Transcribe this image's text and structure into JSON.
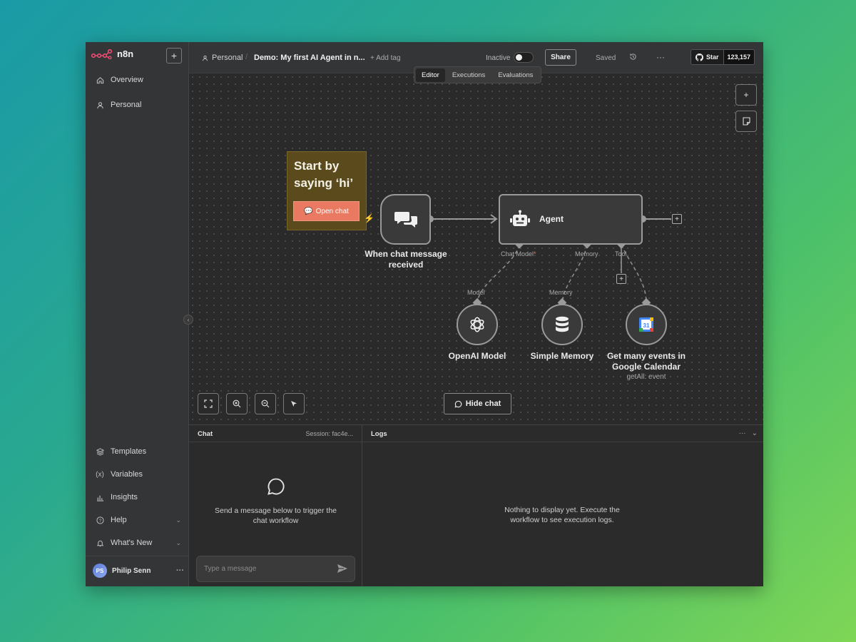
{
  "app": {
    "brand": "n8n"
  },
  "sidebar": {
    "items": [
      {
        "label": "Overview",
        "icon": "home-icon"
      },
      {
        "label": "Personal",
        "icon": "user-icon"
      }
    ],
    "bottom_items": [
      {
        "label": "Templates",
        "icon": "templates-icon"
      },
      {
        "label": "Variables",
        "icon": "variables-icon"
      },
      {
        "label": "Insights",
        "icon": "insights-icon"
      },
      {
        "label": "Help",
        "icon": "help-icon"
      },
      {
        "label": "What's New",
        "icon": "bell-icon"
      }
    ],
    "user": {
      "initials": "PS",
      "name": "Philip Senn"
    }
  },
  "header": {
    "project": "Personal",
    "workflow_name": "Demo: My first AI Agent in n...",
    "add_tag": "+ Add tag",
    "status": "Inactive",
    "share": "Share",
    "saved": "Saved",
    "github_star": "Star",
    "github_count": "123,157",
    "tabs": [
      {
        "label": "Editor",
        "active": true
      },
      {
        "label": "Executions",
        "active": false
      },
      {
        "label": "Evaluations",
        "active": false
      }
    ]
  },
  "canvas": {
    "sticky_note": {
      "text": "Start by saying ‘hi’",
      "button": "Open chat",
      "color": "#5b4a1b"
    },
    "nodes": {
      "trigger": {
        "label": "When chat message received"
      },
      "agent": {
        "label": "Agent",
        "connectors": {
          "chat_model": "Chat Model",
          "chat_model_required": "*",
          "memory": "Memory",
          "tool": "Tool"
        }
      },
      "openai": {
        "label": "OpenAI Model",
        "port": "Model"
      },
      "memory": {
        "label": "Simple Memory",
        "port": "Memory"
      },
      "calendar": {
        "label": "Get many events in Google Calendar",
        "subtitle": "getAll: event"
      }
    },
    "hide_chat": "Hide chat",
    "accent_color": "#e97961"
  },
  "chat_panel": {
    "title": "Chat",
    "session": "Session: fac4e...",
    "empty_text": "Send a message below to trigger the chat workflow",
    "input_placeholder": "Type a message"
  },
  "logs_panel": {
    "title": "Logs",
    "empty_text": "Nothing to display yet. Execute the workflow to see execution logs."
  }
}
